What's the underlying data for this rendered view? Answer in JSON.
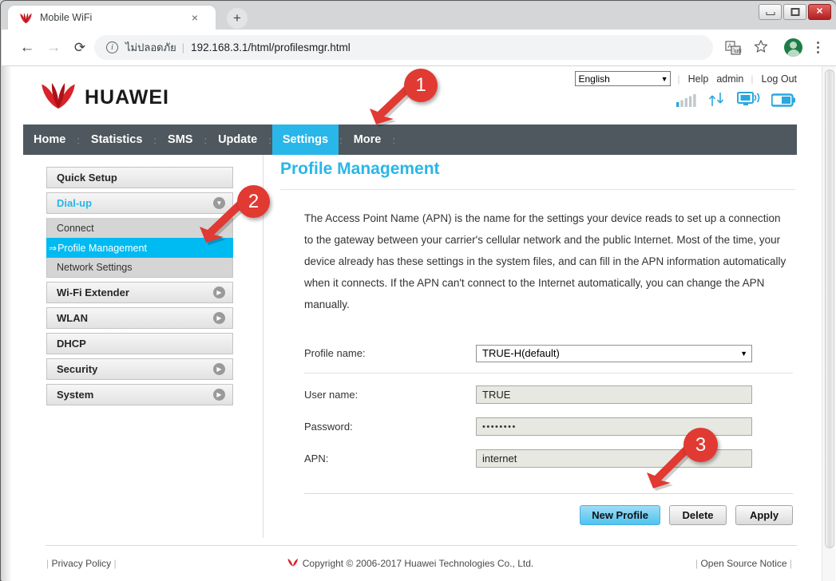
{
  "browser": {
    "tab": {
      "title": "Mobile WiFi",
      "close_label": "×",
      "favicon": "huawei-flower-icon"
    },
    "newtab_label": "+",
    "window_controls": {
      "minimize": "minimize-icon",
      "maximize": "restore-icon",
      "close": "✕"
    },
    "nav": {
      "back": "←",
      "forward": "→",
      "reload": "⟳"
    },
    "omnibox": {
      "info_glyph": "i",
      "security_text": "ไม่ปลอดภัย",
      "separator": "|",
      "url": "192.168.3.1/html/profilesmgr.html"
    },
    "toolbar_icons": [
      "translate-icon",
      "bookmark-star-icon",
      "profile-avatar",
      "kebab-menu-icon"
    ]
  },
  "router": {
    "brand": "HUAWEI",
    "header": {
      "language": "English",
      "language_caret": "▼",
      "links": [
        "Help",
        "admin",
        "Log Out"
      ],
      "status_icons": [
        "signal-bars-icon",
        "data-transfer-icon",
        "wifi-clients-icon",
        "battery-icon"
      ]
    },
    "nav_items": [
      {
        "label": "Home",
        "active": false
      },
      {
        "label": "Statistics",
        "active": false
      },
      {
        "label": "SMS",
        "active": false
      },
      {
        "label": "Update",
        "active": false
      },
      {
        "label": "Settings",
        "active": true
      },
      {
        "label": "More",
        "active": false
      }
    ],
    "sidebar": [
      {
        "label": "Quick Setup",
        "type": "block",
        "expandable": false,
        "open": false
      },
      {
        "label": "Dial-up",
        "type": "block",
        "expandable": true,
        "open": true,
        "children": [
          {
            "label": "Connect",
            "selected": false
          },
          {
            "label": "Profile Management",
            "selected": true,
            "marker": "⇒"
          },
          {
            "label": "Network Settings",
            "selected": false
          }
        ]
      },
      {
        "label": "Wi-Fi Extender",
        "type": "block",
        "expandable": true,
        "open": false
      },
      {
        "label": "WLAN",
        "type": "block",
        "expandable": true,
        "open": false
      },
      {
        "label": "DHCP",
        "type": "block",
        "expandable": false,
        "open": false
      },
      {
        "label": "Security",
        "type": "block",
        "expandable": true,
        "open": false
      },
      {
        "label": "System",
        "type": "block",
        "expandable": true,
        "open": false
      }
    ],
    "main": {
      "title": "Profile Management",
      "description": "The Access Point Name (APN) is the name for the settings your device reads to set up a connection to the gateway between your carrier's cellular network and the public Internet. Most of the time, your device already has these settings in the system files, and can fill in the APN information automatically when it connects. If the APN can't connect to the Internet automatically, you can change the APN manually.",
      "fields": {
        "profile_name": {
          "label": "Profile name:",
          "value": "TRUE-H(default)",
          "caret": "▼"
        },
        "user_name": {
          "label": "User name:",
          "value": "TRUE"
        },
        "password": {
          "label": "Password:",
          "value": "••••••••"
        },
        "apn": {
          "label": "APN:",
          "value": "internet"
        }
      },
      "buttons": [
        {
          "label": "New Profile",
          "primary": true
        },
        {
          "label": "Delete",
          "primary": false
        },
        {
          "label": "Apply",
          "primary": false
        }
      ]
    },
    "footer": {
      "privacy": "Privacy Policy",
      "copyright": "Copyright © 2006-2017 Huawei Technologies Co., Ltd.",
      "open_source": "Open Source Notice"
    }
  },
  "annotations": [
    {
      "number": "1",
      "target": "Settings tab"
    },
    {
      "number": "2",
      "target": "Profile Management sidebar item"
    },
    {
      "number": "3",
      "target": "New Profile button"
    }
  ],
  "colors": {
    "accent_cyan": "#29b6e8",
    "selected_cyan": "#00baf2",
    "navbar_dark": "#4e585e",
    "huawei_red": "#cf0a2c",
    "annotation_red": "#e03a33"
  }
}
